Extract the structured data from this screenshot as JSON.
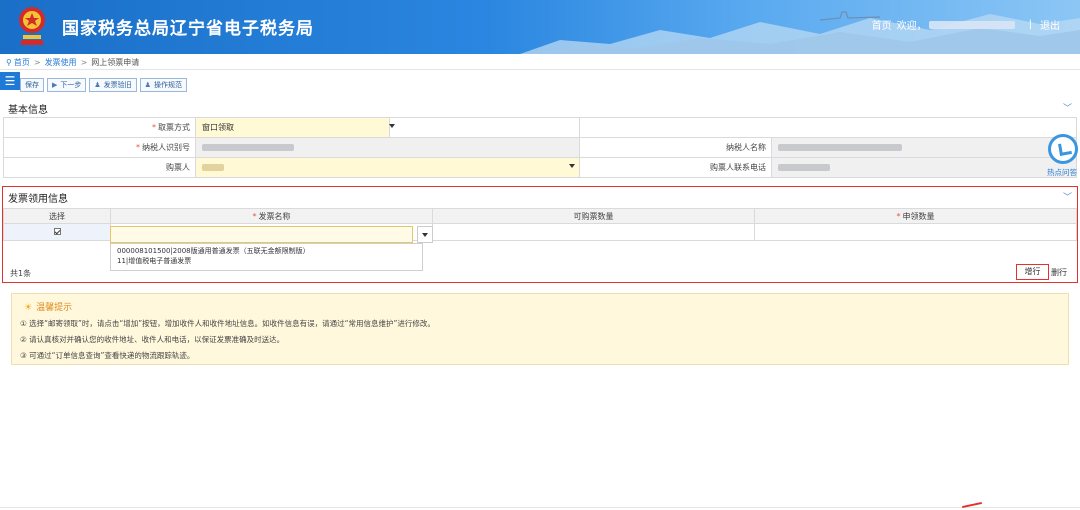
{
  "header": {
    "title": "国家税务总局辽宁省电子税务局",
    "home_link": "首页",
    "welcome": "欢迎，",
    "separator": "|",
    "logout": "退出"
  },
  "breadcrumb": {
    "items": [
      "首页",
      "发票使用",
      "网上领票申请"
    ]
  },
  "toolbar": {
    "menu_icon": "☰",
    "save": "保存",
    "next": "下一步",
    "invoice_check": "发票验旧",
    "guide": "操作规范"
  },
  "basic_info": {
    "title": "基本信息",
    "pickup_method_label": "取票方式",
    "pickup_method_value": "窗口领取",
    "taxpayer_id_label": "纳税人识别号",
    "taxpayer_name_label": "纳税人名称",
    "buyer_label": "购票人",
    "buyer_phone_label": "购票人联系电话"
  },
  "invoice_section": {
    "title": "发票领用信息",
    "columns": [
      "选择",
      "发票名称",
      "可购票数量",
      "申领数量"
    ],
    "dropdown_options": [
      "000008101500|2008版通用普通发票（五联无金额限制版）",
      "11|增值税电子普通发票"
    ],
    "total": "共1条",
    "add_row": "增行",
    "delete_row": "删行"
  },
  "tips": {
    "title": "温馨提示",
    "lines": [
      "① 选择“邮寄领取”时，请点击“增加”按钮，增加收件人和收件地址信息。如收件信息有误，请通过“常用信息维护”进行修改。",
      "② 请认真核对并确认您的收件地址、收件人和电话，以保证发票准确及时送达。",
      "③ 可通过“订单信息查询”查看快递的物流跟踪轨迹。"
    ]
  },
  "float_widget": {
    "label": "热点问答"
  },
  "colors": {
    "header_blue": "#1a6fc7",
    "link_blue": "#2a7cd5",
    "required_orange": "#e35d2b",
    "highlight_red": "#e2322d",
    "tips_bg": "#fff8dc"
  },
  "icons": {
    "breadcrumb_pin": "location-pin-icon",
    "collapse": "chevron-down-icon",
    "tips": "lightbulb-icon",
    "float": "click-cursor-icon"
  }
}
